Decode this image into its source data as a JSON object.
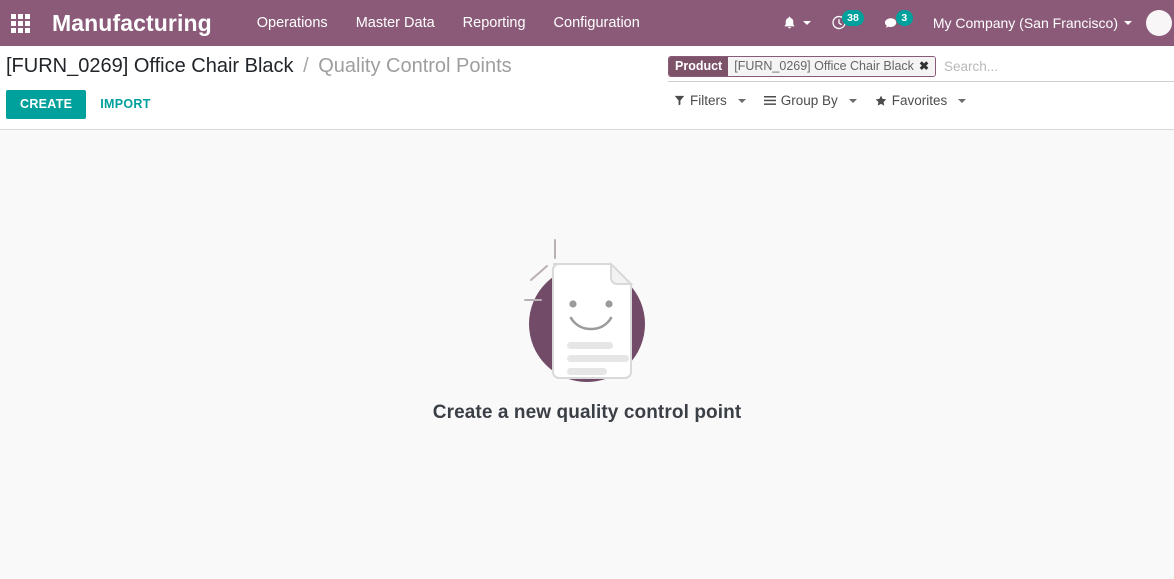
{
  "navbar": {
    "apps_icon": "apps-grid-icon",
    "brand": "Manufacturing",
    "menu": [
      {
        "label": "Operations"
      },
      {
        "label": "Master Data"
      },
      {
        "label": "Reporting"
      },
      {
        "label": "Configuration"
      }
    ],
    "systray": {
      "notification_icon": "bell-icon",
      "activity_icon": "clock-activity-icon",
      "activity_count": "38",
      "messaging_icon": "chat-bubble-icon",
      "messaging_count": "3",
      "company": "My Company (San Francisco)",
      "user_avatar": "avatar-icon"
    }
  },
  "control_panel": {
    "breadcrumb": {
      "parent": "[FURN_0269] Office Chair Black",
      "separator": "/",
      "current": "Quality Control Points"
    },
    "buttons": {
      "create": "CREATE",
      "import": "IMPORT"
    },
    "search": {
      "facet": {
        "label": "Product",
        "value": "[FURN_0269] Office Chair Black",
        "remove_icon": "close-icon"
      },
      "placeholder": "Search...",
      "value": ""
    },
    "filter_bar": [
      {
        "label": "Filters",
        "icon": "funnel-icon"
      },
      {
        "label": "Group By",
        "icon": "list-icon"
      },
      {
        "label": "Favorites",
        "icon": "star-icon"
      }
    ]
  },
  "content": {
    "empty_state": {
      "illustration": "smiling-document-icon",
      "message": "Create a new quality control point"
    }
  },
  "colors": {
    "brand_purple": "#8a5a78",
    "facet_purple": "#7d5369",
    "accent_teal": "#00a09d",
    "illustration_circle": "#714b67",
    "content_bg": "#f9f9f9",
    "text_dark": "#3b3f46"
  }
}
